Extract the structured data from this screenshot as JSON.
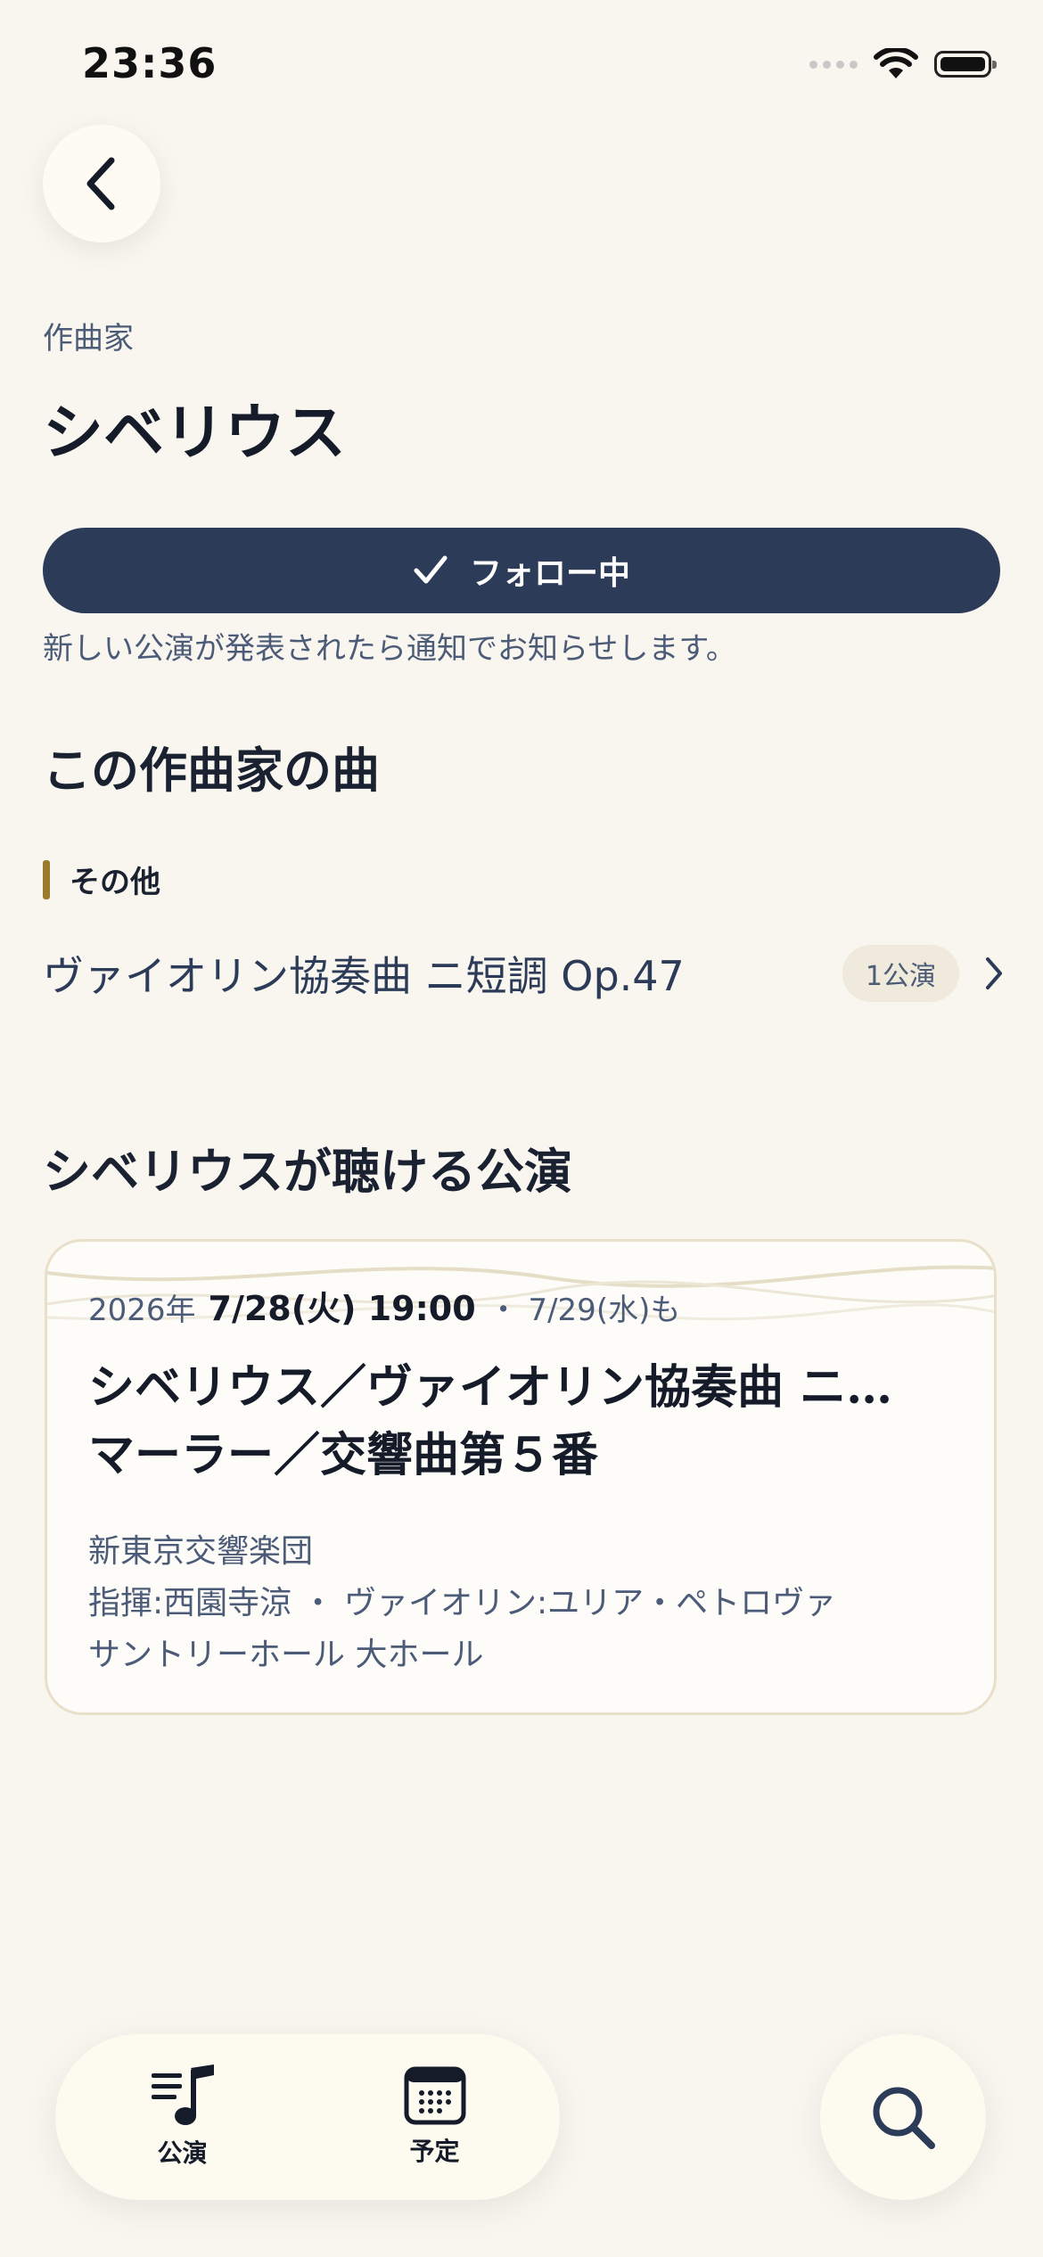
{
  "status_bar": {
    "time": "23:36"
  },
  "header": {
    "kicker": "作曲家",
    "title": "シベリウス"
  },
  "follow": {
    "label": "フォロー中",
    "note": "新しい公演が発表されたら通知でお知らせします。"
  },
  "works_section": {
    "heading": "この作曲家の曲",
    "category": "その他",
    "items": [
      {
        "title": "ヴァイオリン協奏曲 ニ短調 Op.47",
        "badge": "1公演"
      }
    ]
  },
  "concerts_section": {
    "heading": "シベリウスが聴ける公演",
    "cards": [
      {
        "year": "2026年",
        "date": "7/28(火) 19:00",
        "also": "・ 7/29(水)も",
        "title_line1": "シベリウス／ヴァイオリン協奏曲 ニ…",
        "title_line2": "マーラー／交響曲第５番",
        "orchestra": "新東京交響楽団",
        "performers": "指揮:西園寺涼 ・ ヴァイオリン:ユリア・ペトロヴァ",
        "venue": "サントリーホール 大ホール"
      }
    ]
  },
  "tabbar": {
    "tabs": [
      {
        "label": "公演"
      },
      {
        "label": "予定"
      }
    ]
  },
  "colors": {
    "background": "#f9f6ef",
    "primary": "#2c3b58",
    "accent": "#9a7a2c"
  }
}
